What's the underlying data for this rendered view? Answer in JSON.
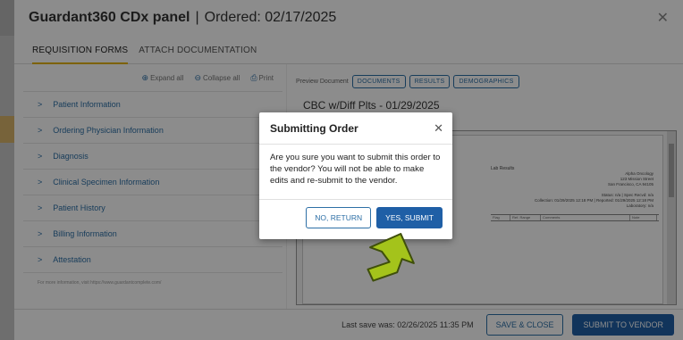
{
  "modal": {
    "title": "Guardant360 CDx panel",
    "separator": "|",
    "ordered": "Ordered: 02/17/2025",
    "close_icon": "close-icon"
  },
  "tabs": [
    {
      "label": "REQUISITION FORMS",
      "active": true
    },
    {
      "label": "ATTACH DOCUMENTATION",
      "active": false
    }
  ],
  "toolbar": {
    "expand_all": "Expand all",
    "collapse_all": "Collapse all",
    "print": "Print"
  },
  "sections": [
    {
      "label": "Patient Information"
    },
    {
      "label": "Ordering Physician Information"
    },
    {
      "label": "Diagnosis"
    },
    {
      "label": "Clinical Specimen Information"
    },
    {
      "label": "Patient History"
    },
    {
      "label": "Billing Information"
    },
    {
      "label": "Attestation"
    }
  ],
  "footnote": "For more information, visit https://www.guardantcomplete.com/",
  "preview": {
    "label": "Preview Document",
    "pills": [
      "DOCUMENTS",
      "RESULTS",
      "DEMOGRAPHICS"
    ],
    "doc_title": "CBC w/Diff Plts - 01/29/2025",
    "lab_results": "Lab Results",
    "address": [
      "Alpha Oncology",
      "123 Mission Street",
      "San Francisco, CA 94105"
    ],
    "status": [
      "Status: n/a | Spec Recvd: n/a",
      "Collection: 01/29/2025 12:18 PM | Reported: 01/29/2025 12:18 PM",
      "Laboratory: n/a"
    ],
    "grid_headers": [
      "Flag",
      "Ref. Range",
      "Comments",
      "Note"
    ]
  },
  "footer": {
    "last_save": "Last save was: 02/26/2025 11:35 PM",
    "save_close": "SAVE & CLOSE",
    "submit_vendor": "SUBMIT TO VENDOR"
  },
  "dialog": {
    "title": "Submitting Order",
    "message": "Are you sure you want to submit this order to the vendor? You will not be able to make edits and re-submit to the vendor.",
    "no_return": "NO, RETURN",
    "yes_submit": "YES, SUBMIT"
  },
  "colors": {
    "accent": "#1f5fa6",
    "tab_underline": "#e3b300",
    "arrow": "#a4c31b"
  }
}
